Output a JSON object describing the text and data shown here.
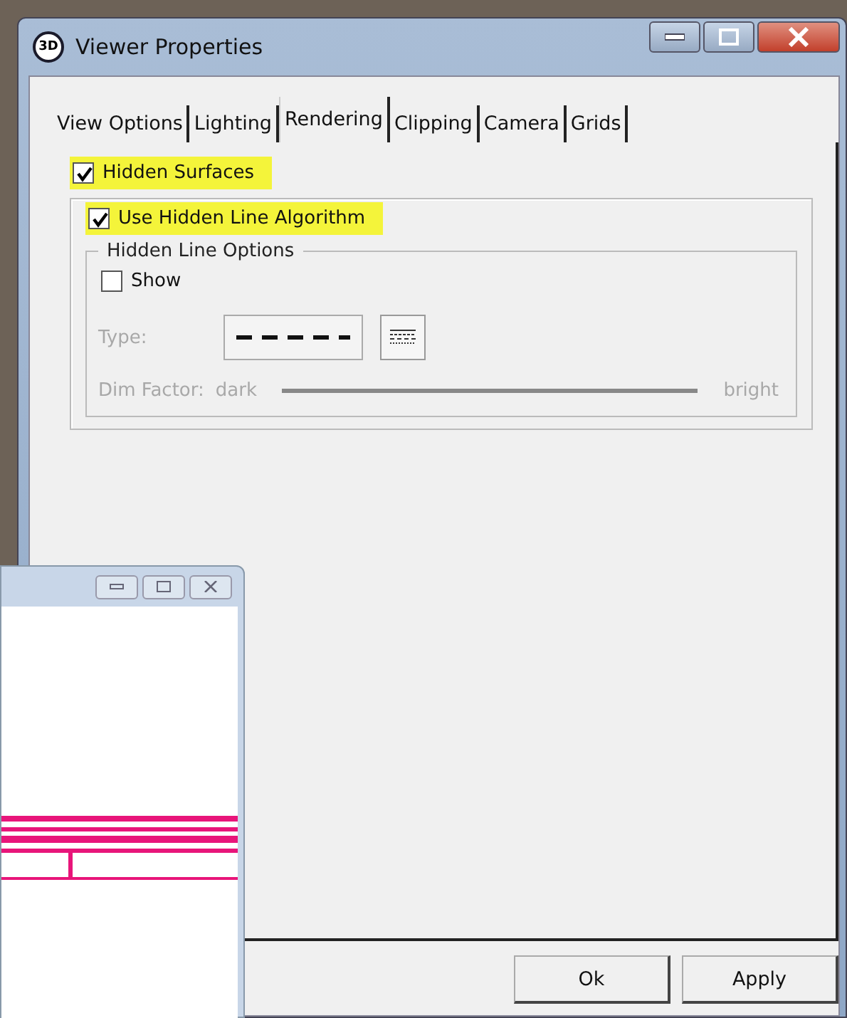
{
  "window": {
    "title": "Viewer Properties",
    "icon_text": "3D"
  },
  "tabs": [
    {
      "label": "View Options",
      "selected": false
    },
    {
      "label": "Lighting",
      "selected": false
    },
    {
      "label": "Rendering",
      "selected": true
    },
    {
      "label": "Clipping",
      "selected": false
    },
    {
      "label": "Camera",
      "selected": false
    },
    {
      "label": "Grids",
      "selected": false
    }
  ],
  "hidden_surfaces": {
    "label": "Hidden Surfaces",
    "checked": true,
    "highlighted": true
  },
  "use_hidden_line": {
    "label": "Use Hidden Line Algorithm",
    "checked": true,
    "highlighted": true
  },
  "hidden_line_options": {
    "title": "Hidden Line Options",
    "disabled": true,
    "show": {
      "label": "Show",
      "checked": false,
      "highlighted": false
    },
    "type_label": "Type:",
    "dim_factor_label": "Dim Factor:",
    "dim_low": "dark",
    "dim_high": "bright"
  },
  "buttons": [
    {
      "label": "Ok"
    },
    {
      "label": "Apply"
    }
  ]
}
